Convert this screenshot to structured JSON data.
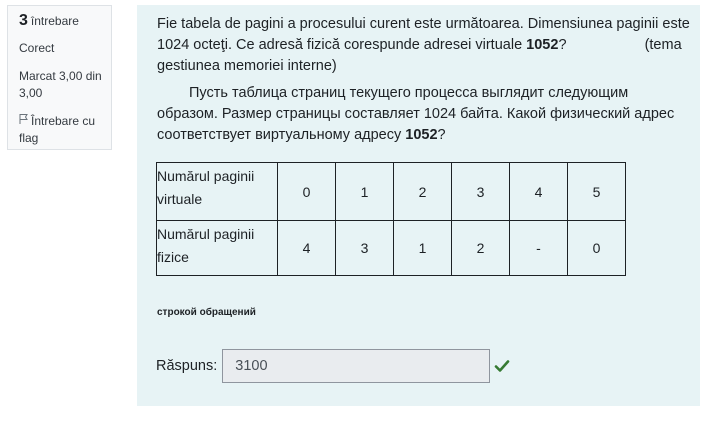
{
  "question_info": {
    "number": "3",
    "label": "întrebare",
    "state": "Corect",
    "grade": "Marcat 3,00 din 3,00",
    "flag_label": "Întrebare cu flag"
  },
  "question": {
    "ro_text": "Fie tabela de pagini a procesului curent este următoarea. Dimensiunea paginii este 1024 octeţi. Ce adresă fizică corespunde adresei virtuale",
    "ro_address": "1052",
    "ro_after": "?",
    "ro_topic": "(tema gestiunea memoriei interne)",
    "ru_text": "Пусть таблица страниц текущего процесса выглядит следующим образом. Размер страницы составляет 1024 байта. Какой физический адрес соответствует виртуальному адресу",
    "ru_address": "1052",
    "ru_after": "?"
  },
  "table": {
    "row1": {
      "label": "Numărul paginii virtuale",
      "values": [
        "0",
        "1",
        "2",
        "3",
        "4",
        "5"
      ]
    },
    "row2": {
      "label": "Numărul paginii fizice",
      "values": [
        "4",
        "3",
        "1",
        "2",
        "-",
        "0"
      ]
    }
  },
  "note": "строкой обращений",
  "answer": {
    "label": "Răspuns:",
    "value": "3100",
    "status_color": "#357a32"
  }
}
